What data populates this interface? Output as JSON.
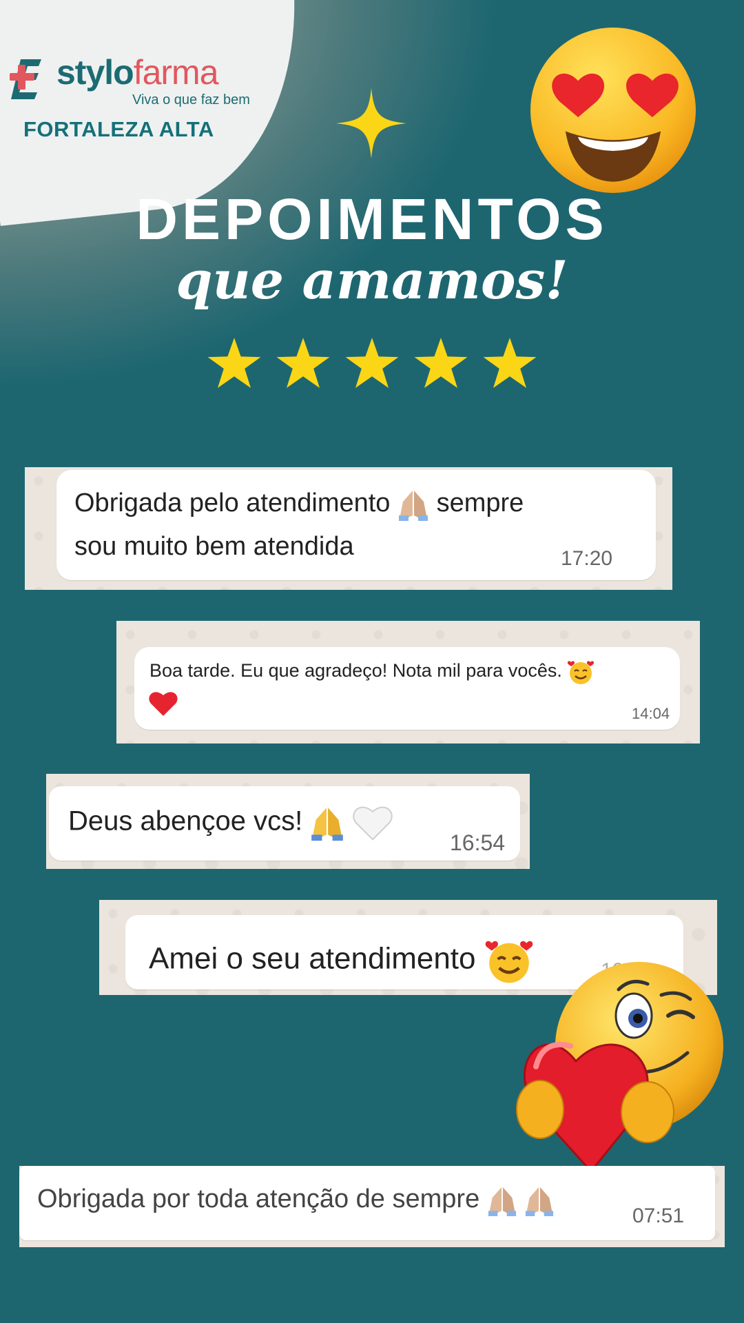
{
  "logo": {
    "brand_part1": "stylo",
    "brand_part2": "farma",
    "tagline": "Viva o que faz bem",
    "location": "FORTALEZA ALTA"
  },
  "header": {
    "title": "DEPOIMENTOS",
    "subtitle": "que amamos!",
    "rating_stars": 5
  },
  "testimonials": [
    {
      "line1": "Obrigada pelo atendimento",
      "line1_after": "sempre",
      "line2": "sou muito bem atendida",
      "time": "17:20"
    },
    {
      "text": "Boa tarde. Eu que agradeço! Nota mil para vocês.",
      "time": "14:04"
    },
    {
      "text": "Deus abençoe vcs!",
      "time": "16:54"
    },
    {
      "text": "Amei o seu atendimento",
      "time": "10:53"
    },
    {
      "text": "Obrigada por toda atenção de sempre",
      "time": "07:51"
    }
  ],
  "icons": [
    "sparkle-icon",
    "heart-eyes-emoji",
    "star-icon",
    "praying-hands-emoji",
    "smiling-hearts-emoji",
    "red-heart-emoji",
    "white-heart-emoji",
    "winking-heart-emoji"
  ],
  "colors": {
    "background": "#1d6670",
    "brand_teal": "#1c6b73",
    "brand_red": "#e1575e",
    "star_yellow": "#fbd616",
    "chat_bg": "#ece5dd"
  }
}
